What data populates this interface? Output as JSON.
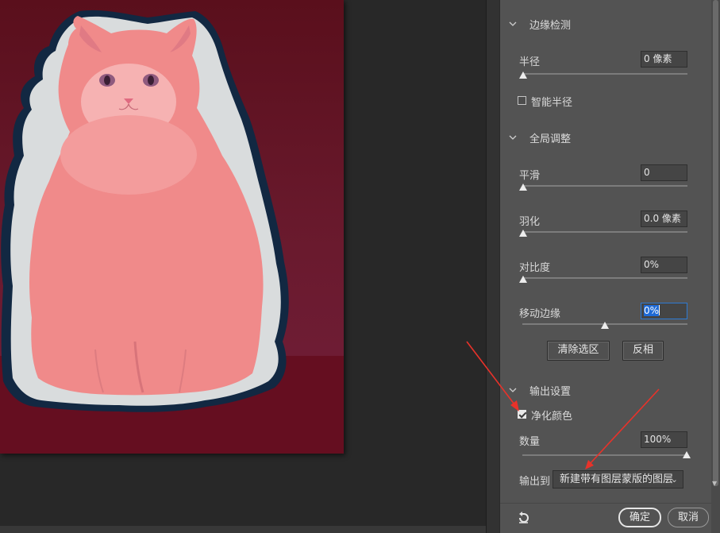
{
  "panel": {
    "edge_detection": {
      "title": "边缘检测",
      "radius_label": "半径",
      "radius_value": "0 像素",
      "radius_level": 0,
      "smart_radius_label": "智能半径",
      "smart_radius_checked": false
    },
    "global_refine": {
      "title": "全局调整",
      "smooth_label": "平滑",
      "smooth_value": "0",
      "smooth_level": 0,
      "feather_label": "羽化",
      "feather_value": "0.0 像素",
      "feather_level": 0,
      "contrast_label": "对比度",
      "contrast_value": "0%",
      "contrast_level": 0,
      "shift_edge_label": "移动边缘",
      "shift_edge_value": "0%",
      "shift_edge_level": 0.5,
      "clear_selection_label": "清除选区",
      "invert_label": "反相"
    },
    "output": {
      "title": "输出设置",
      "decontaminate_label": "净化颜色",
      "decontaminate_checked": true,
      "amount_label": "数量",
      "amount_value": "100%",
      "amount_level": 1.0,
      "output_to_label": "输出到",
      "output_to_value": "新建带有图层蒙版的图层"
    },
    "footer": {
      "ok_label": "确定",
      "cancel_label": "取消"
    }
  },
  "icons": {
    "section_toggle": "chevron-down-icon",
    "reset": "reset-icon",
    "dropdown": "chevron-down-icon"
  },
  "colors": {
    "annotation_arrow": "#e8322a",
    "selection_highlight": "#1e6ad6",
    "overlay_tint": "#f08a8a"
  }
}
